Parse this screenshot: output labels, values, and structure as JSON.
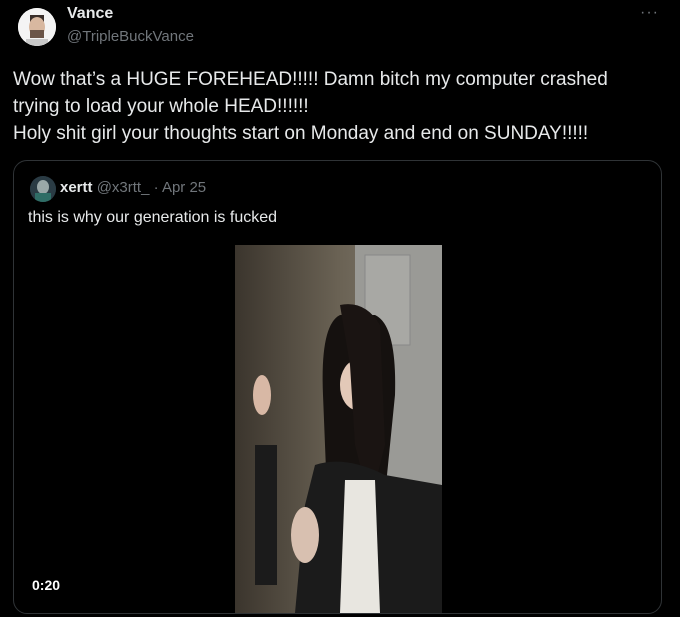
{
  "tweet": {
    "author_name": "Vance",
    "author_handle": "@TripleBuckVance",
    "more_label": "···",
    "text_lines": [
      "Wow that’s a HUGE FOREHEAD!!!!! Damn bitch my computer crashed",
      "trying to load your whole HEAD!!!!!!",
      "Holy shit girl your thoughts start on Monday and end on SUNDAY!!!!!"
    ]
  },
  "quote": {
    "author_name": "xertt",
    "author_handle": "@x3rtt_",
    "separator": "·",
    "date": "Apr 25",
    "text": "this is why our generation is fucked",
    "video_duration": "0:20"
  },
  "icons": {
    "more": "more-horizontal-icon"
  },
  "colors": {
    "background": "#000000",
    "text": "#e7e9ea",
    "muted": "#71767b",
    "border": "#2f3336"
  }
}
